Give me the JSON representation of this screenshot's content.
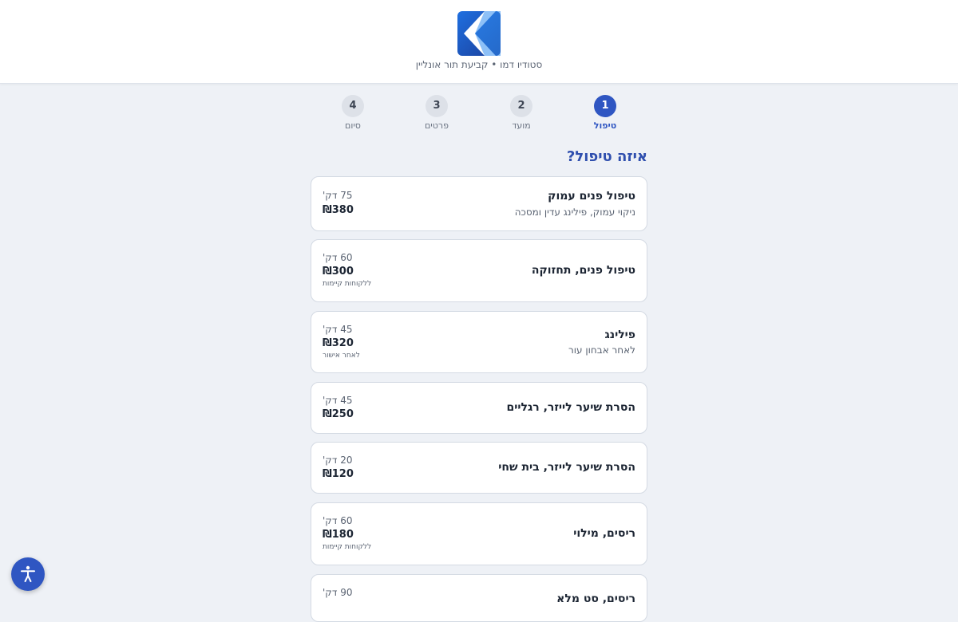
{
  "header": {
    "logo_name": "studio-logo",
    "subtitle": "סטודיו דמו • קביעת תור אונליין"
  },
  "stepper": {
    "steps": [
      {
        "number": "1",
        "label": "טיפול",
        "active": true
      },
      {
        "number": "2",
        "label": "מועד",
        "active": false
      },
      {
        "number": "3",
        "label": "פרטים",
        "active": false
      },
      {
        "number": "4",
        "label": "סיום",
        "active": false
      }
    ]
  },
  "main": {
    "question": "איזה טיפול?",
    "services": [
      {
        "name": "טיפול פנים עמוק",
        "description": "ניקוי עמוק, פילינג עדין ומסכה",
        "duration": "75 דק'",
        "price": "₪380",
        "note": ""
      },
      {
        "name": "טיפול פנים, תחזוקה",
        "description": "",
        "duration": "60 דק'",
        "price": "₪300",
        "note": "ללקוחות קיימות"
      },
      {
        "name": "פילינג",
        "description": "לאחר אבחון עור",
        "duration": "45 דק'",
        "price": "₪320",
        "note": "לאחר אישור"
      },
      {
        "name": "הסרת שיער לייזר, רגליים",
        "description": "",
        "duration": "45 דק'",
        "price": "₪250",
        "note": ""
      },
      {
        "name": "הסרת שיער לייזר, בית שחי",
        "description": "",
        "duration": "20 דק'",
        "price": "₪120",
        "note": ""
      },
      {
        "name": "ריסים, מילוי",
        "description": "",
        "duration": "60 דק'",
        "price": "₪180",
        "note": "ללקוחות קיימות"
      },
      {
        "name": "ריסים, סט מלא",
        "description": "",
        "duration": "90 דק'",
        "price": "",
        "note": ""
      }
    ]
  },
  "accessibility": {
    "icon": "accessibility-icon"
  },
  "colors": {
    "accent": "#2f56c2",
    "heading": "#2f4fae",
    "background": "#eef1f6",
    "card_border": "#d4dae3"
  }
}
